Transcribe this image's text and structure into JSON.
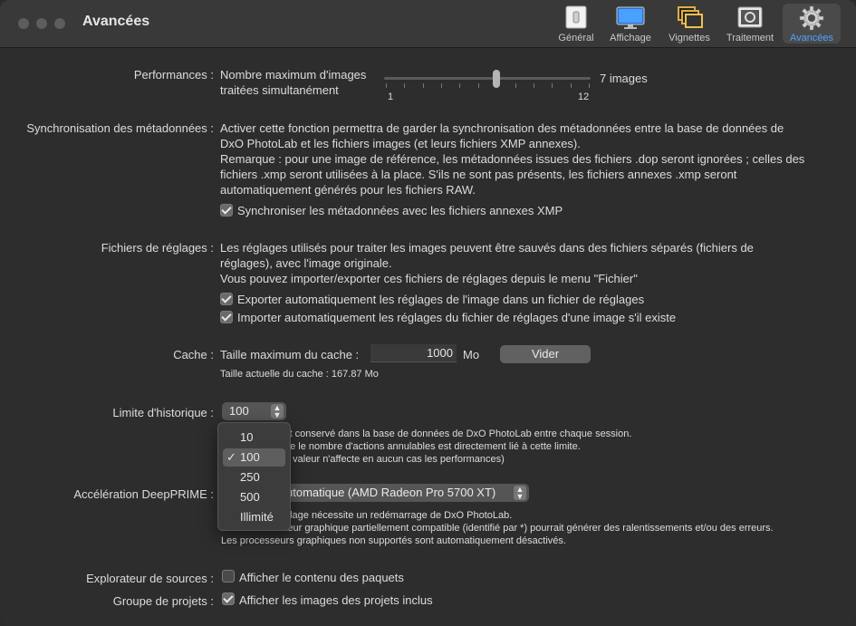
{
  "window": {
    "title": "Avancées"
  },
  "toolbar": {
    "items": [
      {
        "label": "Général",
        "icon": "switch-icon"
      },
      {
        "label": "Affichage",
        "icon": "monitor-icon"
      },
      {
        "label": "Vignettes",
        "icon": "thumbnails-icon"
      },
      {
        "label": "Traitement",
        "icon": "processing-icon"
      },
      {
        "label": "Avancées",
        "icon": "gear-icon",
        "active": true
      }
    ]
  },
  "performances": {
    "label": "Performances :",
    "desc_line1": "Nombre maximum d'images",
    "desc_line2": "traitées simultanément",
    "slider_min": "1",
    "slider_max": "12",
    "slider_value_text": "7 images",
    "slider_value": 7
  },
  "sync": {
    "label": "Synchronisation des métadonnées :",
    "lines": [
      "Activer cette fonction permettra de garder la synchronisation des métadonnées entre la base de données de",
      "DxO PhotoLab et les fichiers images (et leurs fichiers XMP annexes).",
      "Remarque : pour une image de référence, les métadonnées issues des fichiers .dop seront ignorées ; celles des",
      "fichiers .xmp seront utilisées à la place. S'ils ne sont pas présents, les fichiers annexes .xmp seront",
      "automatiquement générés pour les fichiers RAW."
    ],
    "checkbox_label": "Synchroniser les métadonnées avec les fichiers annexes XMP"
  },
  "settings_files": {
    "label": "Fichiers de réglages :",
    "lines": [
      "Les réglages utilisés pour traiter les images peuvent être sauvés dans des fichiers séparés (fichiers de",
      "réglages), avec l'image originale.",
      "Vous pouvez importer/exporter ces fichiers de réglages depuis le menu \"Fichier\""
    ],
    "export_label": "Exporter automatiquement les réglages de l'image dans un fichier de réglages",
    "import_label": "Importer automatiquement les réglages du fichier de réglages d'une image s'il existe"
  },
  "cache": {
    "label": "Cache :",
    "size_label": "Taille maximum du cache :",
    "size_value": "1000",
    "unit": "Mo",
    "clear_button": "Vider",
    "current": "Taille actuelle du cache : 167.87 Mo"
  },
  "history": {
    "label": "Limite d'historique :",
    "selected": "100",
    "note_lines": [
      "st conservé dans la base de données de DxO PhotoLab entre chaque session.",
      "ue le nombre d'actions annulables est directement lié à cette limite.",
      "e valeur n'affecte en aucun cas les performances)"
    ],
    "options": [
      "10",
      "100",
      "250",
      "500",
      "Illimité"
    ]
  },
  "deepprime": {
    "label": "Accélération DeepPRIME :",
    "selected": "utomatique (AMD Radeon Pro 5700 XT)",
    "note_lines": [
      "glage nécessite un redémarrage de DxO PhotoLab.",
      "ourour processeur graphique partiellement compatible (identifié par *) pourrait générer des ralentissements et/ou des erreurs.",
      "Les processeurs graphiques non supportés sont automatiquement désactivés."
    ]
  },
  "explorer": {
    "label": "Explorateur de sources :",
    "checkbox_label": "Afficher le contenu des paquets"
  },
  "projects": {
    "label": "Groupe de projets :",
    "checkbox_label": "Afficher les images des projets inclus"
  }
}
